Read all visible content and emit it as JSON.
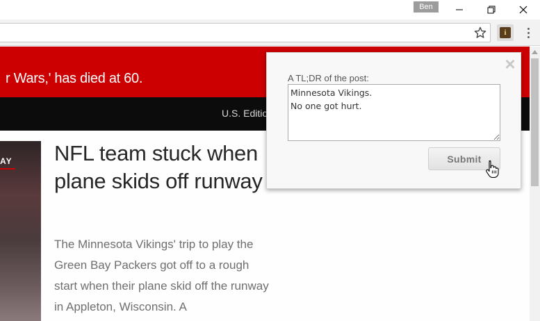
{
  "titlebar": {
    "profile_name": "Ben"
  },
  "toolbar": {
    "bookmark_icon": "star-icon",
    "extension_icon": "info-icon",
    "extension_glyph": "i"
  },
  "page": {
    "breaking_text": "r Wars,' has died at 60.",
    "edition_text": "U.S. Edition",
    "hero_tag": "AY",
    "headline": "NFL team stuck when plane skids off runway",
    "summary": "The Minnesota Vikings' trip to play the Green Bay Packers got off to a rough start when their plane skid off the runway in Appleton, Wisconsin. A"
  },
  "popup": {
    "label": "A TL;DR of the post:",
    "textarea_value": "Minnesota Vikings.\nNo one got hurt.",
    "submit_label": "Submit",
    "close_glyph": "×"
  },
  "colors": {
    "breaking_red": "#cc0000",
    "nav_dark": "#0c0c0c"
  }
}
